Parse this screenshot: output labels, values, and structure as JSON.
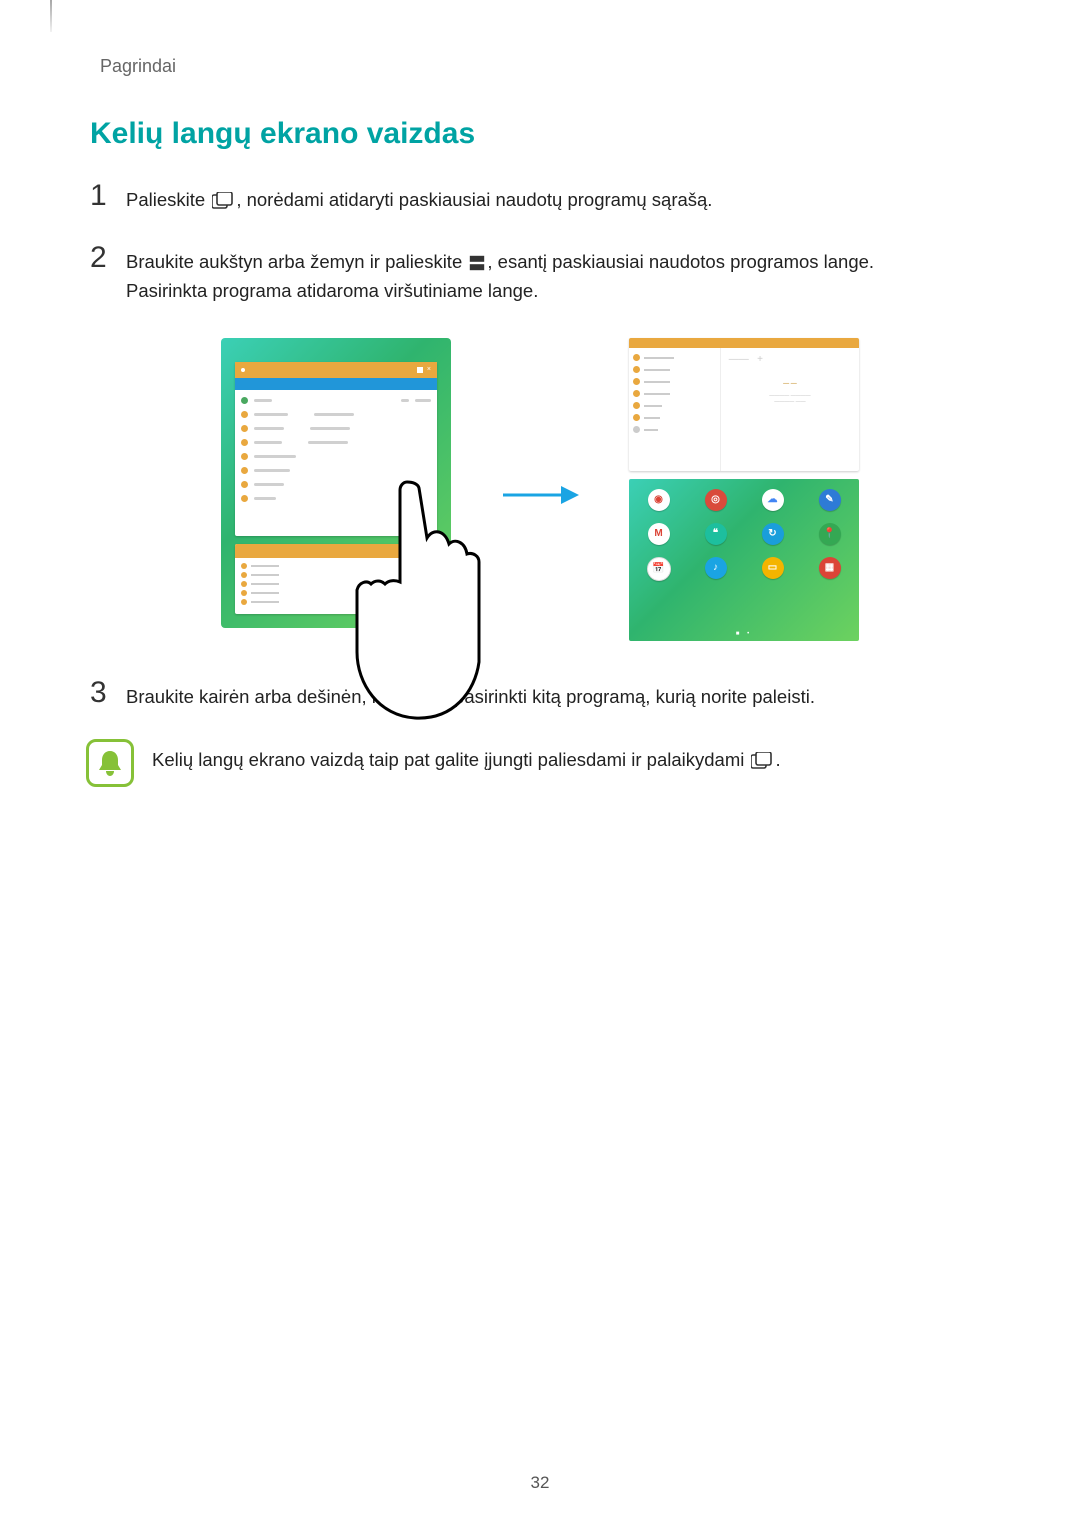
{
  "section": "Pagrindai",
  "heading": "Kelių langų ekrano vaizdas",
  "page_number": "32",
  "steps": {
    "s1": {
      "num": "1",
      "before": "Palieskite ",
      "after": ", norėdami atidaryti paskiausiai naudotų programų sąrašą.",
      "icon": "recent-apps-icon"
    },
    "s2": {
      "num": "2",
      "line1_before": "Braukite aukštyn arba žemyn ir palieskite ",
      "line1_after": ", esantį paskiausiai naudotos programos lange.",
      "line2": "Pasirinkta programa atidaroma viršutiniame lange.",
      "icon": "split-screen-icon"
    },
    "s3": {
      "num": "3",
      "text": "Braukite kairėn arba dešinėn, norėdami pasirinkti kitą programą, kurią norite paleisti."
    }
  },
  "note": {
    "before": "Kelių langų ekrano vaizdą taip pat galite įjungti paliesdami ir palaikydami ",
    "after": ".",
    "icon": "recent-apps-icon"
  },
  "icons": {
    "recent_apps": "recent-apps-icon",
    "split_screen": "split-screen-icon",
    "bell": "bell-icon"
  }
}
